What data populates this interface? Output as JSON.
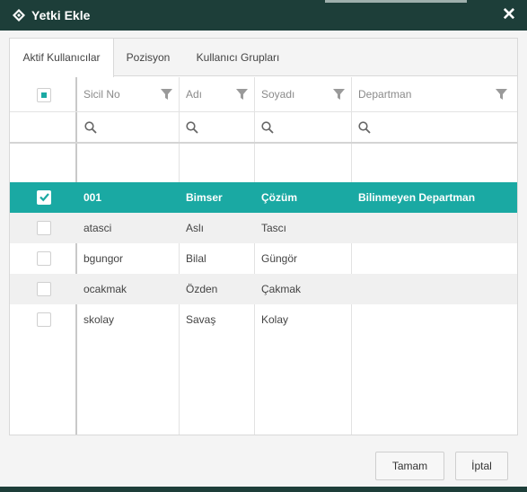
{
  "window": {
    "title": "Yetki Ekle",
    "close_glyph": "✕"
  },
  "tabs": [
    {
      "label": "Aktif Kullanıcılar",
      "active": true
    },
    {
      "label": "Pozisyon",
      "active": false
    },
    {
      "label": "Kullanıcı Grupları",
      "active": false
    }
  ],
  "columns": [
    "Sicil No",
    "Adı",
    "Soyadı",
    "Departman"
  ],
  "rows": [
    {
      "checked": true,
      "sicil": "001",
      "adi": "Bimser",
      "soyadi": "Çözüm",
      "departman": "Bilinmeyen Departman"
    },
    {
      "checked": false,
      "sicil": "atasci",
      "adi": "Aslı",
      "soyadi": "Tascı",
      "departman": ""
    },
    {
      "checked": false,
      "sicil": "bgungor",
      "adi": "Bilal",
      "soyadi": "Güngör",
      "departman": ""
    },
    {
      "checked": false,
      "sicil": "ocakmak",
      "adi": "Özden",
      "soyadi": "Çakmak",
      "departman": ""
    },
    {
      "checked": false,
      "sicil": "skolay",
      "adi": "Savaş",
      "soyadi": "Kolay",
      "departman": ""
    }
  ],
  "buttons": {
    "ok": "Tamam",
    "cancel": "İptal"
  },
  "colors": {
    "titlebar": "#1d3e39",
    "selected_row": "#1aa9a3",
    "accent": "#1aa9a3"
  },
  "icons": {
    "title": "diamond-icon",
    "filter": "funnel-icon",
    "search": "search-icon",
    "check": "checkmark-icon"
  }
}
